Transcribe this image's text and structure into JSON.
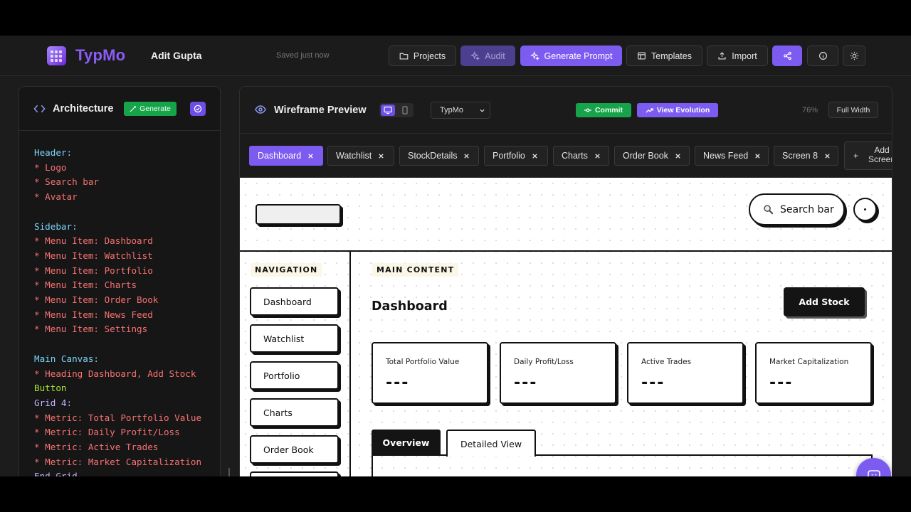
{
  "topbar": {
    "brand": "TypMo",
    "user": "Adit Gupta",
    "save_status": "Saved just now",
    "buttons": {
      "projects": "Projects",
      "audit": "Audit",
      "generate_prompt": "Generate Prompt",
      "templates": "Templates",
      "import": "Import"
    }
  },
  "left_panel": {
    "title": "Architecture",
    "generate": "Generate",
    "code_lines": [
      {
        "c": "h",
        "t": "Header:"
      },
      {
        "c": "b",
        "t": "* Logo"
      },
      {
        "c": "b",
        "t": "* Search bar"
      },
      {
        "c": "b",
        "t": "* Avatar"
      },
      {
        "c": "",
        "t": ""
      },
      {
        "c": "h",
        "t": "Sidebar:"
      },
      {
        "c": "b",
        "t": "* Menu Item: Dashboard"
      },
      {
        "c": "b",
        "t": "* Menu Item: Watchlist"
      },
      {
        "c": "b",
        "t": "* Menu Item: Portfolio"
      },
      {
        "c": "b",
        "t": "* Menu Item: Charts"
      },
      {
        "c": "b",
        "t": "* Menu Item: Order Book"
      },
      {
        "c": "b",
        "t": "* Menu Item: News Feed"
      },
      {
        "c": "b",
        "t": "* Menu Item: Settings"
      },
      {
        "c": "",
        "t": ""
      },
      {
        "c": "h",
        "t": "Main Canvas:"
      },
      {
        "c": "b",
        "t": "* Heading Dashboard, Add Stock"
      },
      {
        "c": "t",
        "t": "Button"
      },
      {
        "c": "g",
        "t": "Grid 4:"
      },
      {
        "c": "b",
        "t": "* Metric: Total Portfolio Value"
      },
      {
        "c": "b",
        "t": "* Metric: Daily Profit/Loss"
      },
      {
        "c": "b",
        "t": "* Metric: Active Trades"
      },
      {
        "c": "b",
        "t": "* Metric: Market Capitalization"
      },
      {
        "c": "g",
        "t": "End Grid"
      }
    ]
  },
  "preview": {
    "title": "Wireframe Preview",
    "project_select": "TypMo",
    "commit": "Commit",
    "view_evolution": "View Evolution",
    "zoom": "76%",
    "full_width": "Full Width",
    "tabs": [
      "Dashboard",
      "Watchlist",
      "StockDetails",
      "Portfolio",
      "Charts",
      "Order Book",
      "News Feed",
      "Screen 8"
    ],
    "add_screen": "Add Screen"
  },
  "wireframe": {
    "search": "Search bar",
    "nav_tag": "NAVIGATION",
    "main_tag": "MAIN CONTENT",
    "nav_items": [
      "Dashboard",
      "Watchlist",
      "Portfolio",
      "Charts",
      "Order Book"
    ],
    "heading": "Dashboard",
    "add_stock": "Add Stock",
    "metrics": [
      {
        "label": "Total Portfolio Value",
        "value": "---"
      },
      {
        "label": "Daily Profit/Loss",
        "value": "---"
      },
      {
        "label": "Active Trades",
        "value": "---"
      },
      {
        "label": "Market Capitalization",
        "value": "---"
      }
    ],
    "tab_overview": "Overview",
    "tab_detailed": "Detailed View"
  },
  "colors": {
    "accent": "#7c5cf0",
    "success": "#16a34a",
    "brand_text": "#8b5cf6"
  }
}
